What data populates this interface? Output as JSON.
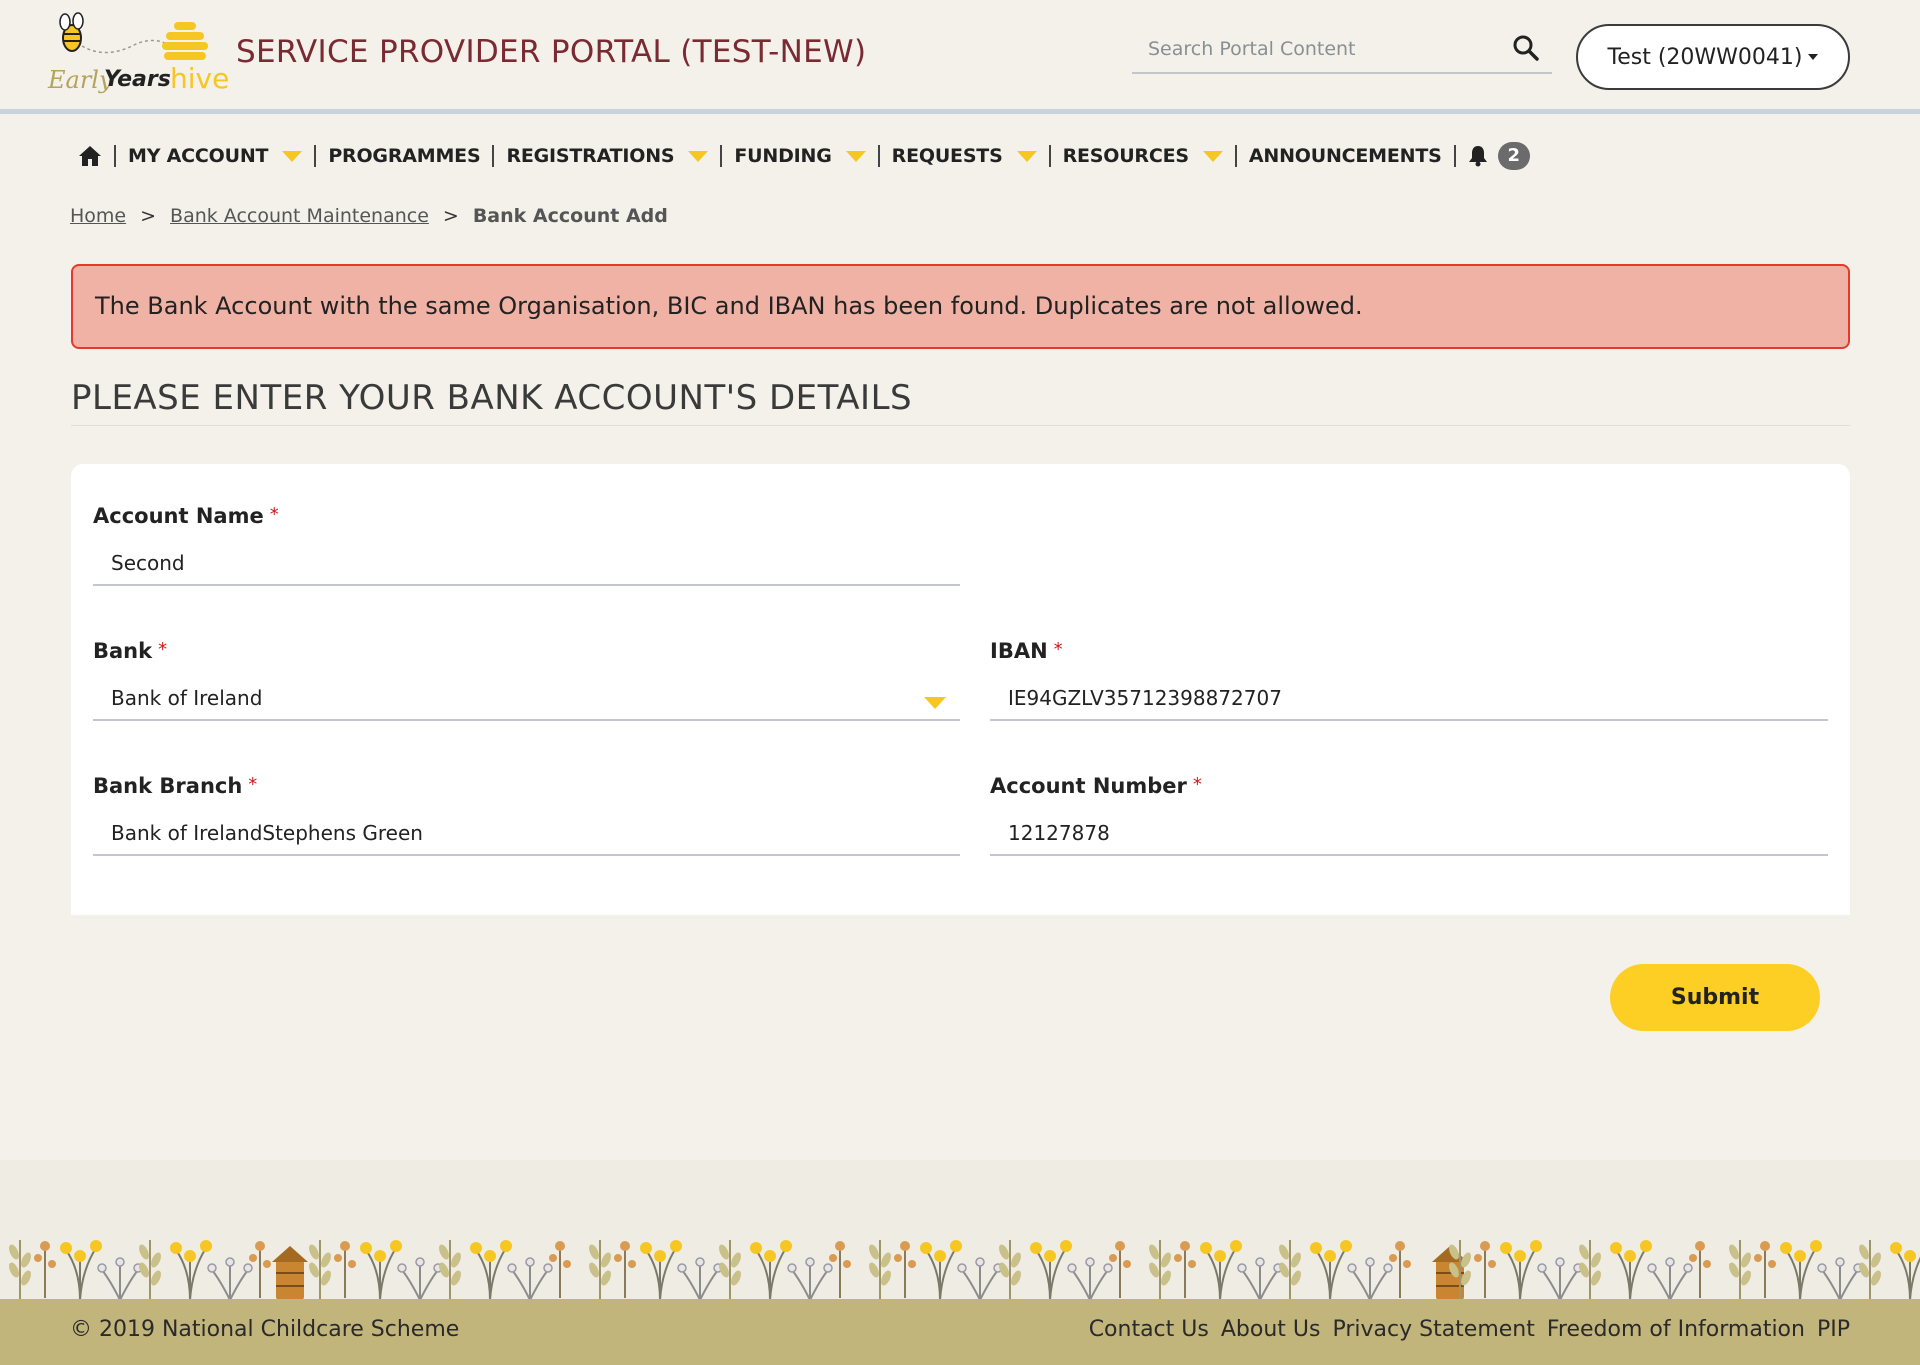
{
  "header": {
    "logo_text": "EarlyYearshive",
    "title": "SERVICE PROVIDER PORTAL (TEST-NEW)",
    "search_placeholder": "Search Portal Content",
    "user_label": "Test (20WW0041)"
  },
  "nav": {
    "items": [
      {
        "label": "MY ACCOUNT",
        "dropdown": true
      },
      {
        "label": "PROGRAMMES",
        "dropdown": false
      },
      {
        "label": "REGISTRATIONS",
        "dropdown": true
      },
      {
        "label": "FUNDING",
        "dropdown": true
      },
      {
        "label": "REQUESTS",
        "dropdown": true
      },
      {
        "label": "RESOURCES",
        "dropdown": true
      },
      {
        "label": "ANNOUNCEMENTS",
        "dropdown": false
      }
    ],
    "notification_count": "2"
  },
  "breadcrumb": {
    "home": "Home",
    "separator": ">",
    "parent": "Bank Account Maintenance",
    "current": "Bank Account Add"
  },
  "alert": {
    "message": "The Bank Account with the same Organisation, BIC and IBAN has been found. Duplicates are not allowed."
  },
  "form": {
    "title": "PLEASE ENTER YOUR BANK ACCOUNT'S DETAILS",
    "required_marker": "*",
    "account_name": {
      "label": "Account Name",
      "value": "Second"
    },
    "bank": {
      "label": "Bank",
      "value": "Bank of Ireland"
    },
    "iban": {
      "label": "IBAN",
      "value": "IE94GZLV35712398872707"
    },
    "bank_branch": {
      "label": "Bank Branch",
      "value": "Bank of IrelandStephens Green"
    },
    "account_number": {
      "label": "Account Number",
      "value": "12127878"
    },
    "submit_label": "Submit"
  },
  "footer": {
    "copyright": "© 2019 National Childcare Scheme",
    "links": [
      "Contact Us",
      "About Us",
      "Privacy Statement",
      "Freedom of Information",
      "PIP"
    ]
  },
  "colors": {
    "accent_yellow": "#fdcf24",
    "title_maroon": "#7a2a32",
    "alert_bg": "#f1b2a6",
    "alert_border": "#e23b2e",
    "footer_bg": "#c2b57c",
    "page_bg": "#f3f1ea"
  }
}
